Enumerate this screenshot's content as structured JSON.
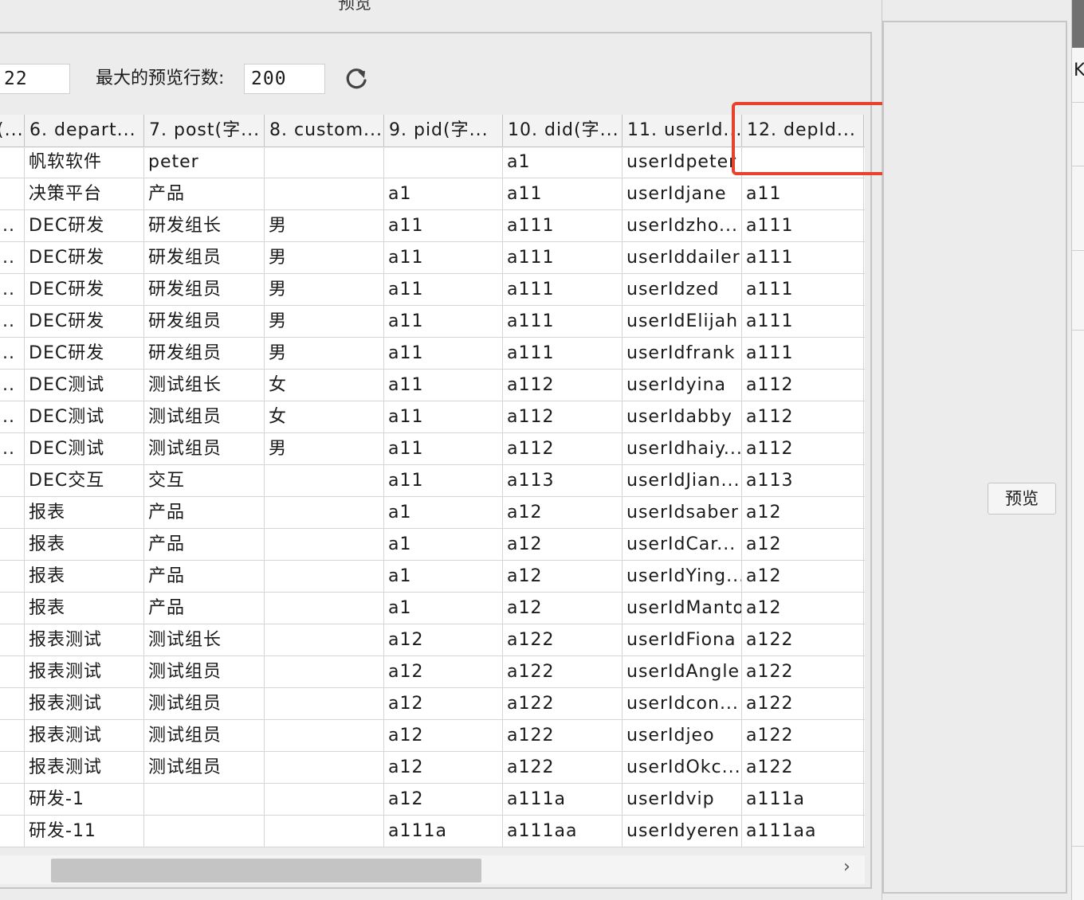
{
  "dialog": {
    "title": "预览"
  },
  "toolbar": {
    "row_count_value": "22",
    "max_rows_label": "最大的预览行数:",
    "max_rows_value": "200",
    "refresh_icon": "refresh-icon"
  },
  "table": {
    "headers": [
      "(...",
      "6. depart...",
      "7. post(字...",
      "8. custom...",
      "9. pid(字...",
      "10. did(字...",
      "11. userId...",
      "12. depId..."
    ],
    "rows": [
      [
        "",
        "帆软软件",
        "peter",
        "",
        "",
        "a1",
        "userIdpeter",
        ""
      ],
      [
        "",
        "决策平台",
        "产品",
        "",
        "a1",
        "a11",
        "userIdjane",
        "a11"
      ],
      [
        "...",
        "DEC研发",
        "研发组长",
        "男",
        "a11",
        "a111",
        "userIdzho...",
        "a111"
      ],
      [
        "...",
        "DEC研发",
        "研发组员",
        "男",
        "a11",
        "a111",
        "userIddailer",
        "a111"
      ],
      [
        "...",
        "DEC研发",
        "研发组员",
        "男",
        "a11",
        "a111",
        "userIdzed",
        "a111"
      ],
      [
        "...",
        "DEC研发",
        "研发组员",
        "男",
        "a11",
        "a111",
        "userIdElijah",
        "a111"
      ],
      [
        "...",
        "DEC研发",
        "研发组员",
        "男",
        "a11",
        "a111",
        "userIdfrank",
        "a111"
      ],
      [
        "...",
        "DEC测试",
        "测试组长",
        "女",
        "a11",
        "a112",
        "userIdyina",
        "a112"
      ],
      [
        "...",
        "DEC测试",
        "测试组员",
        "女",
        "a11",
        "a112",
        "userIdabby",
        "a112"
      ],
      [
        "...",
        "DEC测试",
        "测试组员",
        "男",
        "a11",
        "a112",
        "userIdhaiy...",
        "a112"
      ],
      [
        "",
        "DEC交互",
        "交互",
        "",
        "a11",
        "a113",
        "userIdJian...",
        "a113"
      ],
      [
        "",
        "报表",
        "产品",
        "",
        "a1",
        "a12",
        "userIdsaber",
        "a12"
      ],
      [
        "",
        "报表",
        "产品",
        "",
        "a1",
        "a12",
        "userIdCar...",
        "a12"
      ],
      [
        "",
        "报表",
        "产品",
        "",
        "a1",
        "a12",
        "userIdYing...",
        "a12"
      ],
      [
        "",
        "报表",
        "产品",
        "",
        "a1",
        "a12",
        "userIdManto",
        "a12"
      ],
      [
        "",
        "报表测试",
        "测试组长",
        "",
        "a12",
        "a122",
        "userIdFiona",
        "a122"
      ],
      [
        "",
        "报表测试",
        "测试组员",
        "",
        "a12",
        "a122",
        "userIdAngle",
        "a122"
      ],
      [
        "",
        "报表测试",
        "测试组员",
        "",
        "a12",
        "a122",
        "userIdcon...",
        "a122"
      ],
      [
        "",
        "报表测试",
        "测试组员",
        "",
        "a12",
        "a122",
        "userIdjeo",
        "a122"
      ],
      [
        "",
        "报表测试",
        "测试组员",
        "",
        "a12",
        "a122",
        "userIdOkc...",
        "a122"
      ],
      [
        "",
        "研发-1",
        "",
        "",
        "a12",
        "a111a",
        "userIdvip",
        "a111a"
      ],
      [
        "",
        "研发-11",
        "",
        "",
        "a111a",
        "a111aa",
        "userIdyeren",
        "a111aa"
      ]
    ]
  },
  "right_panel": {
    "preview_button": "预览",
    "edge_letter": "K"
  },
  "colors": {
    "highlight": "#e8412c",
    "background": "#ececec"
  }
}
